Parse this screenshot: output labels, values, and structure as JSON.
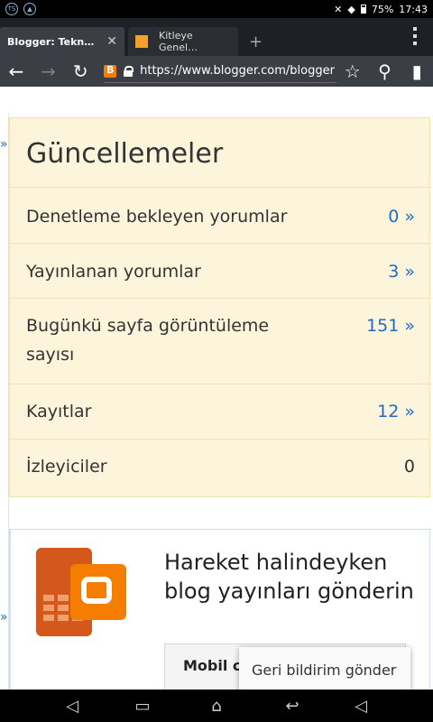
{
  "status_bar": {
    "battery": "75%",
    "time": "17:43",
    "icons": [
      "ts-icon",
      "nav-app-icon",
      "mute-icon",
      "wifi-icon",
      "battery-icon"
    ]
  },
  "tabs": [
    {
      "title": "Blogger: Tekn…",
      "active": true
    },
    {
      "title": "Kitleye Genel…",
      "active": false
    }
  ],
  "toolbar": {
    "url": "https://www.blogger.com/blogger"
  },
  "page": {
    "updates": {
      "title": "Güncellemeler",
      "rows": [
        {
          "label": "Denetleme bekleyen yorumlar",
          "value": "0 »"
        },
        {
          "label": "Yayınlanan yorumlar",
          "value": "3 »"
        },
        {
          "label": "Bugünkü sayfa görüntüleme sayısı",
          "value": "151 »"
        },
        {
          "label": "Kayıtlar",
          "value": "12 »"
        },
        {
          "label": "İzleyiciler",
          "value": "0"
        }
      ]
    },
    "mobile": {
      "title": "Hareket halindeyken blog yayınları gönderin",
      "button": "Mobil ci"
    },
    "left_rail": [
      "»",
      "»"
    ]
  },
  "feedback": {
    "label": "Geri bildirim gönder"
  },
  "colors": {
    "accent": "#1f6bc4",
    "card_bg": "#fdf4dc",
    "blogger_orange": "#f57d00"
  }
}
